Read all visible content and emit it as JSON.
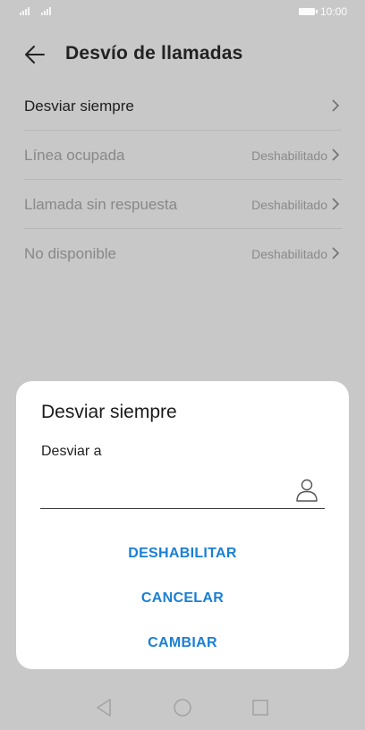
{
  "status": {
    "time": "10:00"
  },
  "header": {
    "title": "Desvío de llamadas"
  },
  "list": [
    {
      "label": "Desviar siempre",
      "value": "",
      "enabled": true
    },
    {
      "label": "Línea ocupada",
      "value": "Deshabilitado",
      "enabled": false
    },
    {
      "label": "Llamada sin respuesta",
      "value": "Deshabilitado",
      "enabled": false
    },
    {
      "label": "No disponible",
      "value": "Deshabilitado",
      "enabled": false
    }
  ],
  "dialog": {
    "title": "Desviar siempre",
    "field_label": "Desviar a",
    "field_value": "",
    "buttons": {
      "disable": "DESHABILITAR",
      "cancel": "CANCELAR",
      "change": "CAMBIAR"
    }
  },
  "colors": {
    "accent": "#1a7fd6",
    "overlay": "#c8c8c8"
  },
  "icons": [
    "signal-icon",
    "battery-icon",
    "back-arrow-icon",
    "chevron-right-icon",
    "contact-icon",
    "nav-back-icon",
    "nav-home-icon",
    "nav-recents-icon"
  ]
}
